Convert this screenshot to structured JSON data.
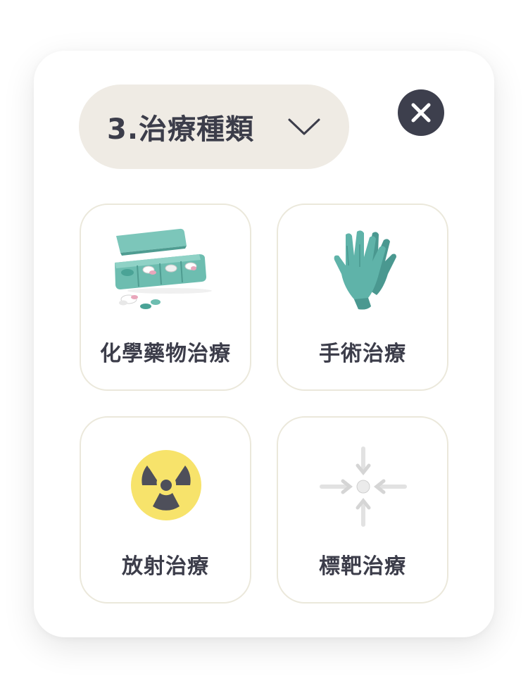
{
  "header": {
    "dropdown_label": "3.治療種類",
    "chevron_icon": "chevron-down-icon",
    "close_icon": "close-icon"
  },
  "colors": {
    "text": "#3c3d4a",
    "dropdown_bg": "#efebe4",
    "close_bg": "#3d3f4d",
    "tile_border": "#ebe8db",
    "teal": "#5fb3a9",
    "radiation_yellow": "#f7e36b"
  },
  "options": [
    {
      "label": "化學藥物治療",
      "icon": "pill-box-icon"
    },
    {
      "label": "手術治療",
      "icon": "surgical-gloves-icon"
    },
    {
      "label": "放射治療",
      "icon": "radiation-icon"
    },
    {
      "label": "標靶治療",
      "icon": "target-arrows-icon"
    }
  ]
}
